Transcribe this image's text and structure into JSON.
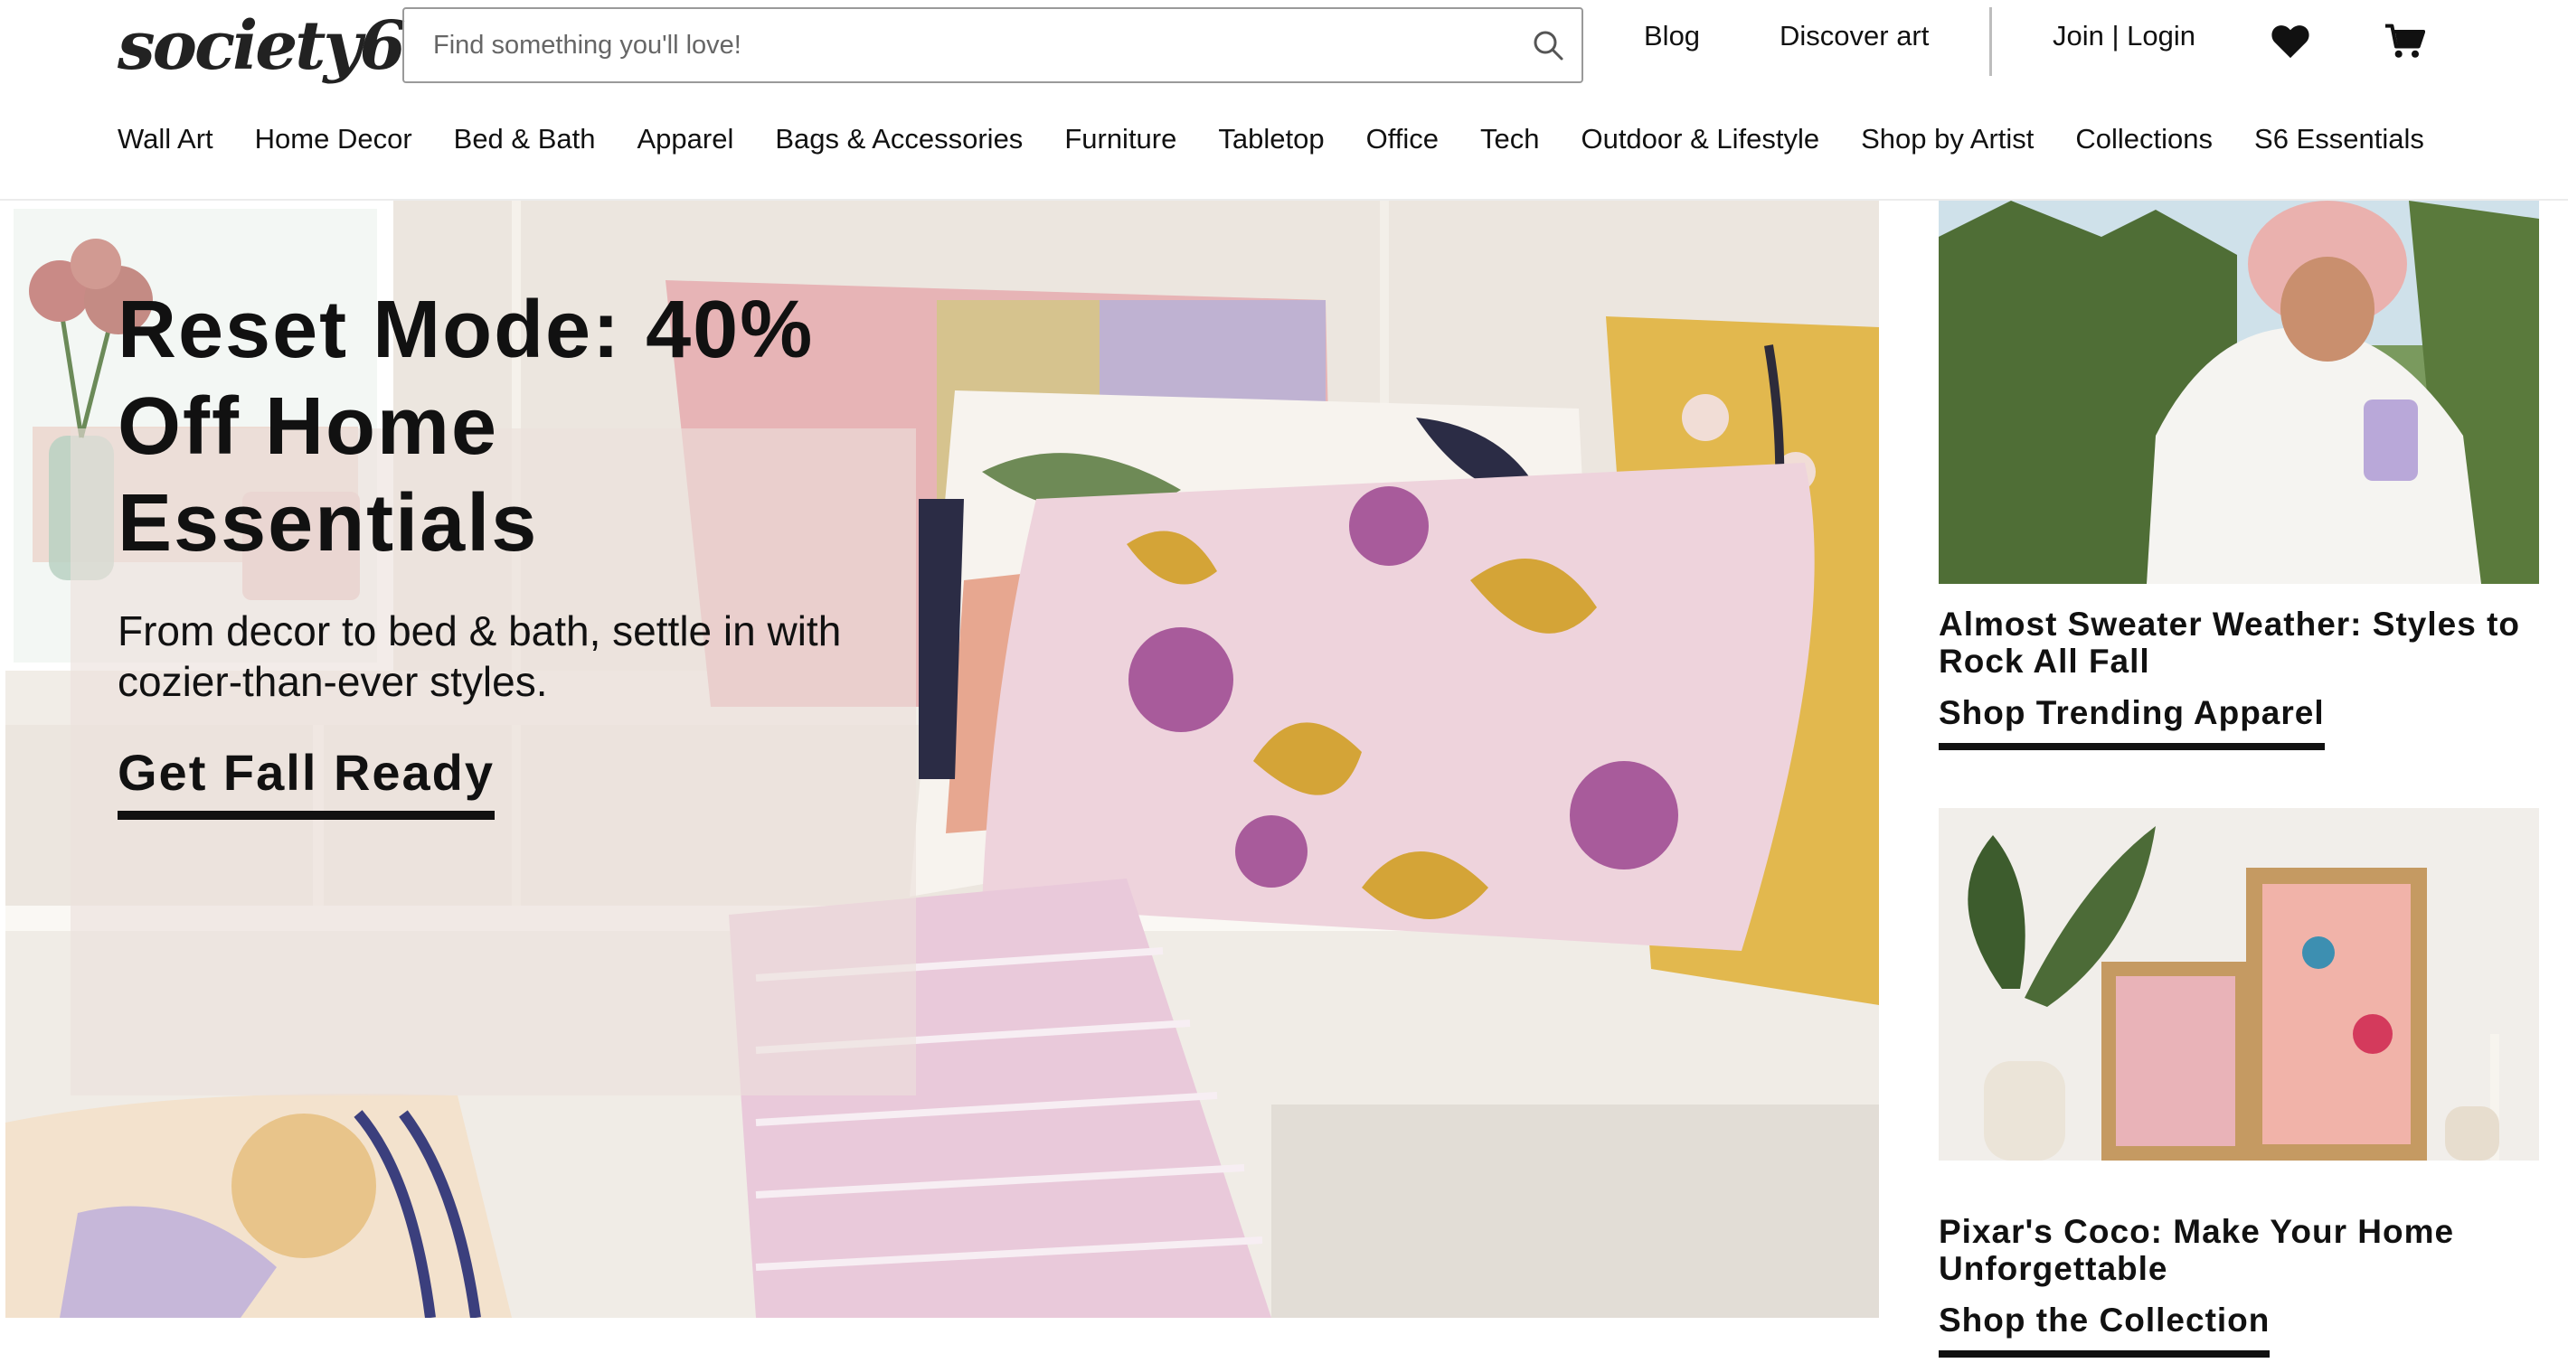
{
  "header": {
    "logo": "society6",
    "search_placeholder": "Find something you'll love!",
    "links": {
      "blog": "Blog",
      "discover": "Discover art",
      "account": "Join | Login"
    }
  },
  "nav": {
    "items": [
      "Wall Art",
      "Home Decor",
      "Bed & Bath",
      "Apparel",
      "Bags & Accessories",
      "Furniture",
      "Tabletop",
      "Office",
      "Tech",
      "Outdoor & Lifestyle",
      "Shop by Artist",
      "Collections",
      "S6 Essentials"
    ]
  },
  "hero": {
    "title": "Reset Mode: 40% Off Home Essentials",
    "subtitle": "From decor to bed & bath, settle in with cozier-than-ever styles.",
    "cta": "Get Fall Ready"
  },
  "cards": [
    {
      "title": "Almost Sweater Weather: Styles to Rock All Fall",
      "cta": "Shop Trending Apparel"
    },
    {
      "title": "Pixar's Coco: Make Your Home Unforgettable",
      "cta": "Shop the Collection"
    }
  ],
  "colors": {
    "text": "#111111",
    "search_border": "#9a9a9a",
    "divider": "#bdbdbd"
  }
}
